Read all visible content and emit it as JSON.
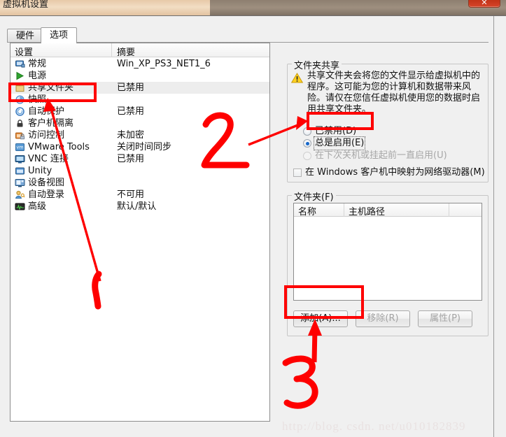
{
  "window": {
    "title": "虚拟机设置",
    "close_label": "✕"
  },
  "tabs": [
    {
      "label": "硬件",
      "active": false
    },
    {
      "label": "选项",
      "active": true
    }
  ],
  "settings_list": {
    "headers": {
      "setting": "设置",
      "summary": "摘要"
    },
    "rows": [
      {
        "icon": "monitor-icon",
        "label": "常规",
        "summary": "Win_XP_PS3_NET1_6",
        "selected": false
      },
      {
        "icon": "play-icon",
        "label": "电源",
        "summary": "",
        "selected": false
      },
      {
        "icon": "folder-icon",
        "label": "共享文件夹",
        "summary": "已禁用",
        "selected": true
      },
      {
        "icon": "snapshot-icon",
        "label": "快照",
        "summary": "",
        "selected": false
      },
      {
        "icon": "autoprotect-icon",
        "label": "自动保护",
        "summary": "已禁用",
        "selected": false
      },
      {
        "icon": "lock-icon",
        "label": "客户机隔离",
        "summary": "",
        "selected": false
      },
      {
        "icon": "access-lock-icon",
        "label": "访问控制",
        "summary": "未加密",
        "selected": false
      },
      {
        "icon": "vmware-tools-icon",
        "label": "VMware Tools",
        "summary": "关闭时间同步",
        "selected": false
      },
      {
        "icon": "vnc-icon",
        "label": "VNC 连接",
        "summary": "已禁用",
        "selected": false
      },
      {
        "icon": "unity-icon",
        "label": "Unity",
        "summary": "",
        "selected": false
      },
      {
        "icon": "device-view-icon",
        "label": "设备视图",
        "summary": "",
        "selected": false
      },
      {
        "icon": "auto-login-icon",
        "label": "自动登录",
        "summary": "不可用",
        "selected": false
      },
      {
        "icon": "advanced-icon",
        "label": "高级",
        "summary": "默认/默认",
        "selected": false
      }
    ]
  },
  "folder_sharing": {
    "group_title": "文件夹共享",
    "warning_icon": "warning-triangle-icon",
    "warning_text": "共享文件夹会将您的文件显示给虚拟机中的程序。这可能为您的计算机和数据带来风险。请仅在您信任虚拟机使用您的数据时启用共享文件夹。",
    "options": [
      {
        "label": "已禁用(D)",
        "checked": false,
        "disabled": false,
        "focused": false
      },
      {
        "label": "总是启用(E)",
        "checked": true,
        "disabled": false,
        "focused": true
      },
      {
        "label": "在下次关机或挂起前一直启用(U)",
        "checked": false,
        "disabled": true,
        "focused": false
      }
    ],
    "map_drive": {
      "label": "在 Windows 客户机中映射为网络驱动器(M)",
      "checked": false
    }
  },
  "folders": {
    "group_title": "文件夹(F)",
    "columns": [
      "名称",
      "主机路径"
    ],
    "rows": [],
    "buttons": [
      {
        "label": "添加(A)...",
        "disabled": false
      },
      {
        "label": "移除(R)",
        "disabled": true
      },
      {
        "label": "属性(P)",
        "disabled": true
      }
    ]
  },
  "annotations": {
    "step1": "1",
    "step2": "2",
    "step3": "3",
    "color": "#fe0000"
  },
  "watermark": "http://blog. csdn. net/u010182839"
}
